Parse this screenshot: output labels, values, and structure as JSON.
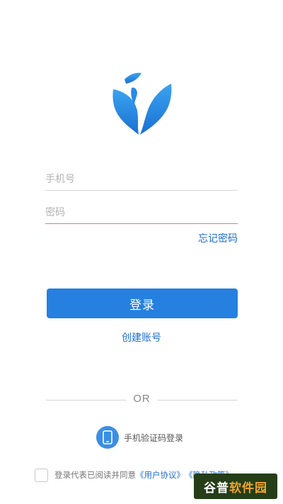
{
  "login": {
    "phone_placeholder": "手机号",
    "password_placeholder": "密码",
    "forgot_password": "忘记密码",
    "login_button": "登录",
    "create_account": "创建账号",
    "or_divider": "OR",
    "sms_login": "手机验证码登录",
    "agreement_prefix": "登录代表已阅读并同意",
    "user_agreement": "《用户协议》",
    "privacy_policy": "《隐私政策》"
  },
  "watermark": {
    "part_a": "谷普",
    "part_b": "软件园"
  },
  "colors": {
    "accent": "#2580e0",
    "link": "#1d6fd6",
    "error_underline": "#e07a7a"
  },
  "icons": {
    "logo": "leaf-logo-icon",
    "sms": "mobile-phone-icon"
  }
}
